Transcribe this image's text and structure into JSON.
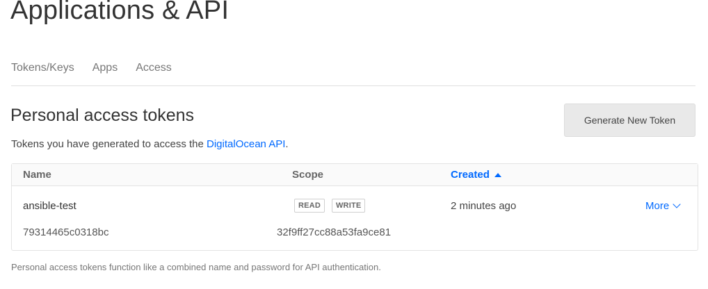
{
  "page": {
    "title": "Applications & API"
  },
  "tabs": [
    {
      "label": "Tokens/Keys"
    },
    {
      "label": "Apps"
    },
    {
      "label": "Access"
    }
  ],
  "section": {
    "title": "Personal access tokens",
    "desc_prefix": "Tokens you have generated to access the ",
    "desc_link": "DigitalOcean API",
    "desc_suffix": ".",
    "generate_button": "Generate New Token",
    "footnote": "Personal access tokens function like a combined name and password for API authentication."
  },
  "table": {
    "headers": {
      "name": "Name",
      "scope": "Scope",
      "created": "Created"
    },
    "sort": {
      "column": "created",
      "direction": "ascending"
    },
    "rows": [
      {
        "name": "ansible-test",
        "scopes": [
          "READ",
          "WRITE"
        ],
        "created": "2 minutes ago",
        "more": "More",
        "token_part_1": "79314465c0318bc",
        "token_part_2": "32f9ff27cc88a53fa9ce81"
      }
    ]
  },
  "colors": {
    "accent": "#0069ff",
    "button_bg": "#e9e9e9",
    "border": "#e3e3e3"
  },
  "icons": {
    "sort": "caret-up-icon",
    "more": "chevron-down-icon"
  }
}
